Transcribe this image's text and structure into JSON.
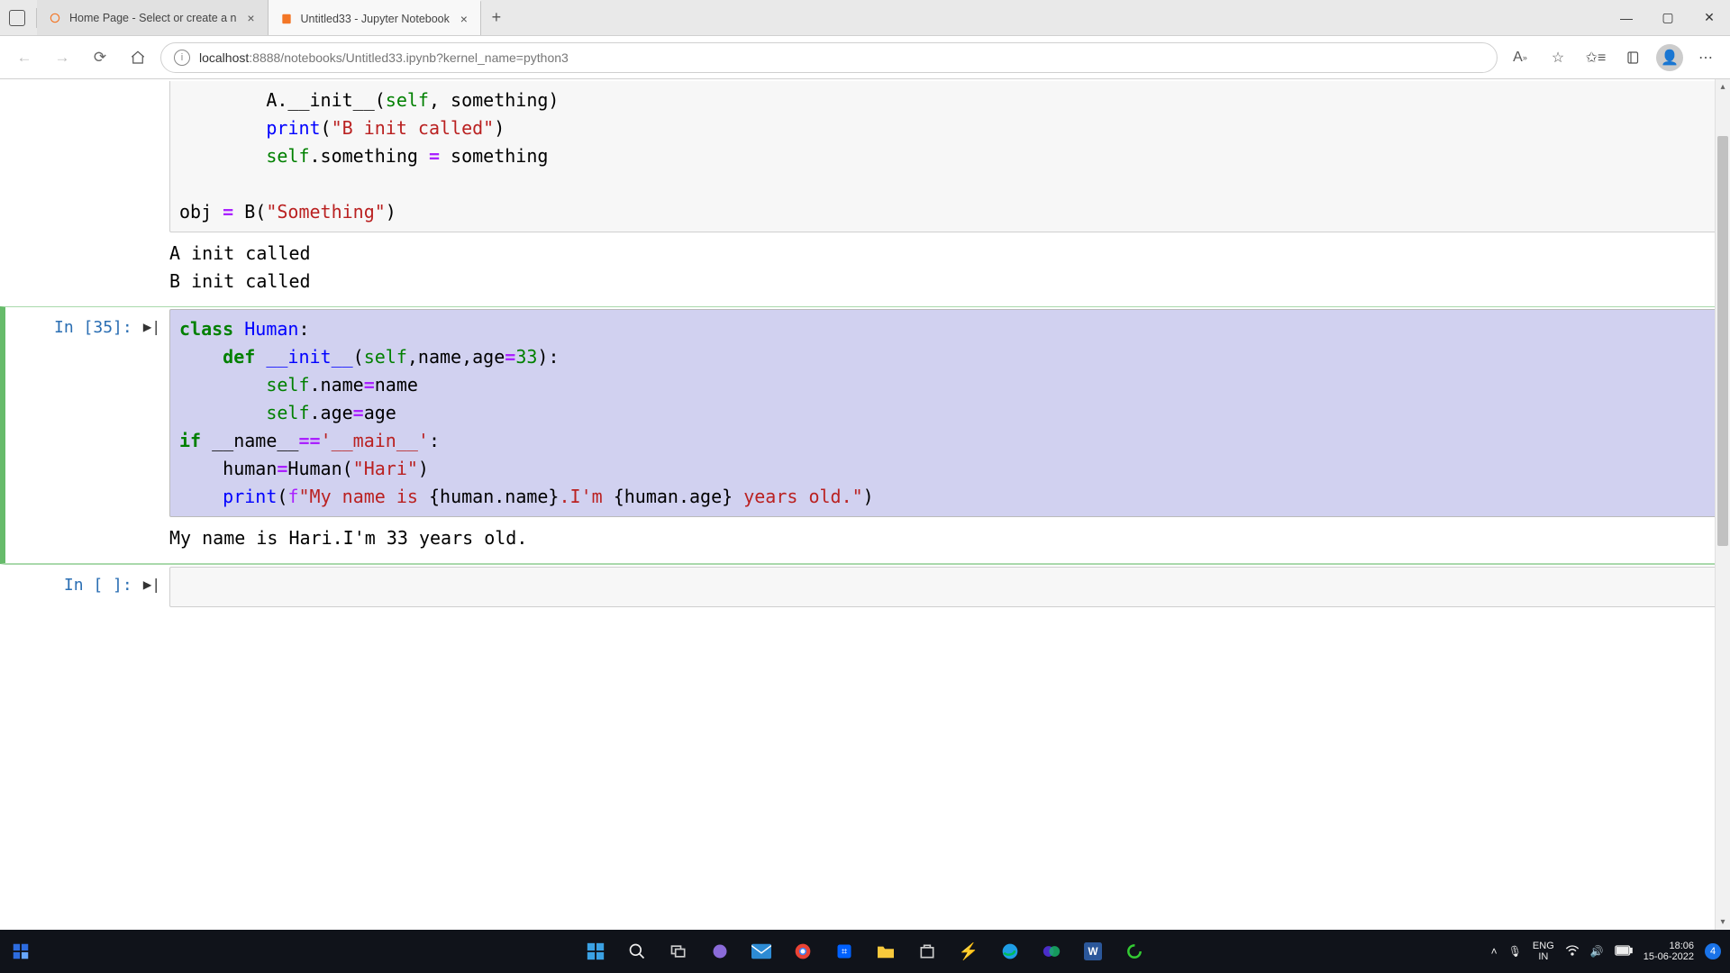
{
  "window": {
    "tabs": [
      {
        "title": "Home Page - Select or create a n",
        "active": false
      },
      {
        "title": "Untitled33 - Jupyter Notebook",
        "active": true
      }
    ]
  },
  "address_bar": {
    "url_host": "localhost",
    "url_rest": ":8888/notebooks/Untitled33.ipynb?kernel_name=python3"
  },
  "cells": {
    "top_partial": {
      "code_html": "        A.__init__(<span class='bn'>self</span>, something)\n        <span class='fn'>print</span>(<span class='str'>\"B init called\"</span>)\n        <span class='bn'>self</span>.something <span class='op'>=</span> something\n\nobj <span class='op'>=</span> B(<span class='str'>\"Something\"</span>)",
      "output": "A init called\nB init called"
    },
    "cell35": {
      "prompt": "In [35]:",
      "code_html": "<span class='kw'>class</span> <span class='fn'>Human</span>:\n    <span class='kw'>def</span> <span class='fn'>__init__</span>(<span class='bn'>self</span>,name,age<span class='op'>=</span><span class='num'>33</span>):\n        <span class='bn'>self</span>.name<span class='op'>=</span>name\n        <span class='bn'>self</span>.age<span class='op'>=</span>age\n<span class='kw'>if</span> __name__<span class='op'>==</span><span class='str'>'__main__'</span>:\n    human<span class='op'>=</span>Human(<span class='str'>\"Hari\"</span>)\n    <span class='fn'>print</span>(<span class='sf'>f</span><span class='str'>\"My name is </span>{human.name}<span class='str'>.I'm </span>{human.age}<span class='str'> years old.\"</span>)",
      "output": "My name is Hari.I'm 33 years old."
    },
    "empty": {
      "prompt": "In [ ]:",
      "code_html": " "
    }
  },
  "taskbar": {
    "lang1": "ENG",
    "lang2": "IN",
    "time": "18:06",
    "date": "15-06-2022",
    "badge": "4"
  }
}
